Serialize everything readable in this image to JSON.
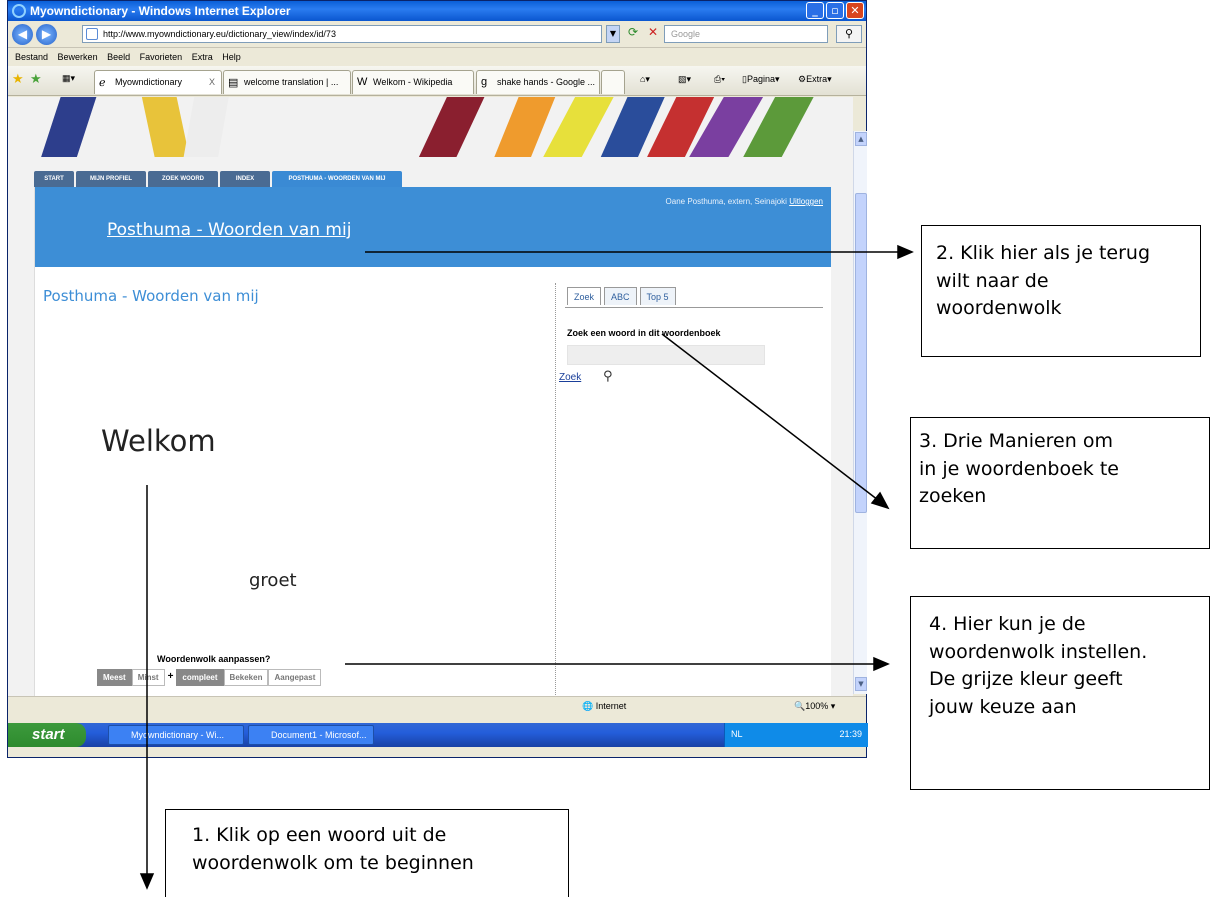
{
  "browser": {
    "title": "Myowndictionary - Windows Internet Explorer",
    "address": "http://www.myowndictionary.eu/dictionary_view/index/id/73",
    "search_placeholder": "Google",
    "menu": [
      "Bestand",
      "Bewerken",
      "Beeld",
      "Favorieten",
      "Extra",
      "Help"
    ],
    "tabs": [
      {
        "label": "Myowndictionary",
        "close": "X",
        "active": true
      },
      {
        "label": "welcome translation | ...",
        "active": false
      },
      {
        "label": "Welkom - Wikipedia",
        "active": false
      },
      {
        "label": "shake hands - Google ...",
        "active": false
      }
    ],
    "command_pagina": "Pagina",
    "command_extra": "Extra",
    "status_zone": "Internet",
    "zoom": "100%"
  },
  "site": {
    "nav": [
      "START",
      "MIJN PROFIEL",
      "ZOEK WOORD",
      "INDEX",
      "POSTHUMA - WOORDEN VAN MIJ"
    ],
    "user_line": "Oane Posthuma, extern, Seinajoki",
    "logout": "Uitloggen",
    "header_title": "Posthuma - Woorden van mij",
    "page_title": "Posthuma - Woorden van mij",
    "cloud_words": [
      "Welkom",
      "groet"
    ],
    "wordcloud_label": "Woordenwolk aanpassen?",
    "filters": {
      "meest": "Meest",
      "minst": "Minst",
      "plus": "+",
      "compleet": "compleet",
      "bekeken": "Bekeken",
      "aangepast": "Aangepast"
    },
    "search_tabs": [
      "Zoek",
      "ABC",
      "Top 5"
    ],
    "search_label": "Zoek een woord in dit woordenboek",
    "search_link": "Zoek"
  },
  "taskbar": {
    "start": "start",
    "items": [
      "Myowndictionary - Wi...",
      "Document1 - Microsof..."
    ],
    "lang": "NL",
    "clock": "21:39"
  },
  "annotations": {
    "a1": [
      "1. Klik op een woord uit de",
      "woordenwolk om te beginnen"
    ],
    "a2": [
      "2. Klik hier als je terug",
      "wilt naar de",
      "woordenwolk"
    ],
    "a3": [
      "3. Drie Manieren  om",
      "in je woordenboek te",
      "zoeken"
    ],
    "a4": [
      "4. Hier kun je de",
      "woordenwolk instellen.",
      "De grijze kleur geeft",
      "jouw keuze aan"
    ]
  },
  "colors": {
    "header_blue": "#3d8ed6",
    "link_blue": "#1a3f9a",
    "xp_title": "#0a5fd8",
    "filter_selected": "#888888"
  }
}
